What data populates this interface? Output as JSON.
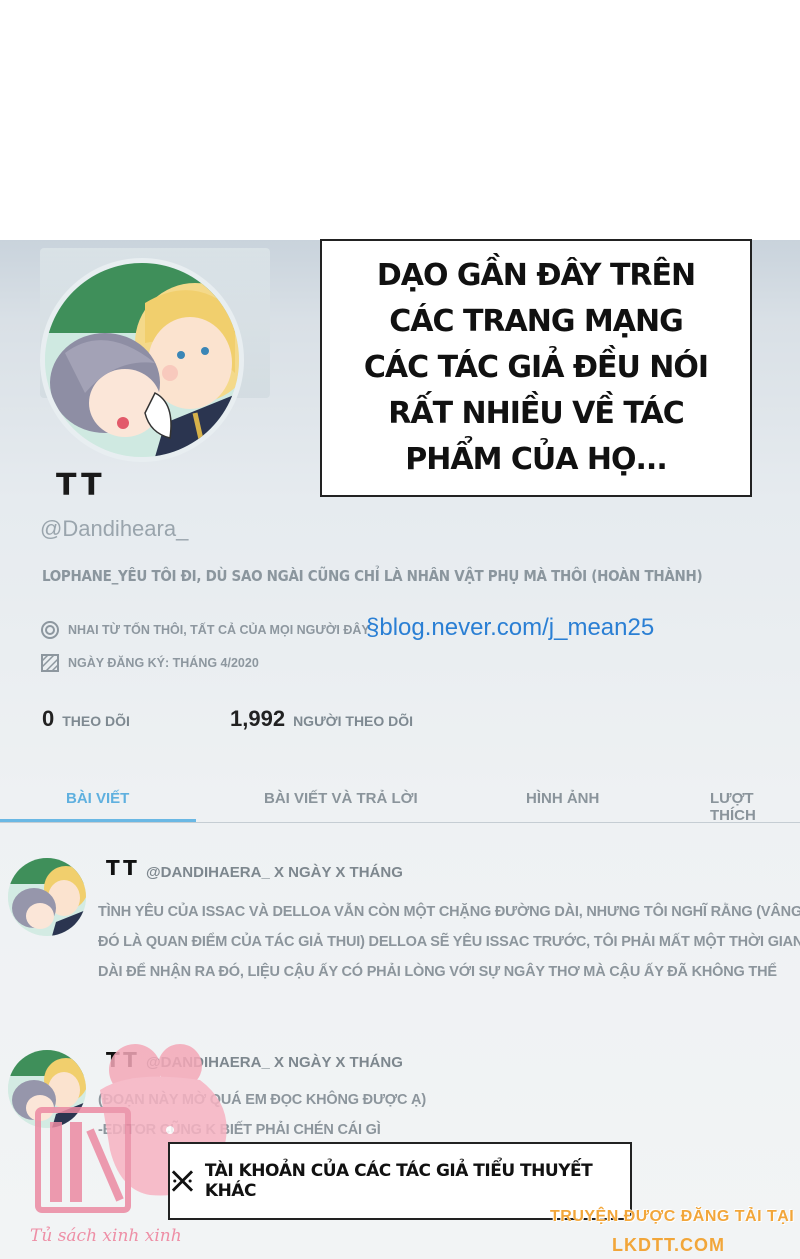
{
  "speech": {
    "text": "DẠO GẦN ĐÂY TRÊN CÁC TRANG MẠNG CÁC TÁC GIẢ ĐỀU NÓI RẤT NHIỀU VỀ TÁC PHẨM CỦA HỌ..."
  },
  "profile": {
    "display_name": "TT",
    "handle": "@Dandiheara_",
    "bio": "LOPHANE_YÊU TÔI ĐI, DÙ SAO NGÀI CŨNG CHỈ LÀ NHÂN VẬT PHỤ MÀ THÔI (HOÀN THÀNH)",
    "location": "NHAI TỪ TỐN THÔI, TẤT CẢ CỦA MỌI NGƯỜI ĐÂY",
    "link": "§blog.never.com/j_mean25",
    "joined": "NGÀY ĐĂNG KÝ: THÁNG 4/2020",
    "following_count": "0",
    "following_label": "THEO DÕI",
    "followers_count": "1,992",
    "followers_label": "NGƯỜI THEO DÕI"
  },
  "tabs": [
    {
      "label": "BÀI VIẾT",
      "active": true
    },
    {
      "label": "BÀI VIẾT VÀ TRẢ LỜI",
      "active": false
    },
    {
      "label": "HÌNH ẢNH",
      "active": false
    },
    {
      "label": "LƯỢT THÍCH",
      "active": false
    }
  ],
  "posts": [
    {
      "name": "TT",
      "meta": "@DANDIHAERA_ X NGÀY X THÁNG",
      "lines": [
        "TÌNH YÊU CỦA ISSAC VÀ DELLOA VẪN CÒN MỘT CHẶNG ĐƯỜNG DÀI, NHƯNG TÔI NGHĨ RẰNG (VÂNG",
        "ĐÓ LÀ QUAN ĐIỂM CỦA TÁC GIẢ THUI) DELLOA SẼ YÊU ISSAC TRƯỚC, TÔI PHẢI MẤT MỘT THỜI GIAN",
        "DÀI ĐỂ NHẬN RA ĐÓ, LIỆU CẬU ẤY CÓ PHẢI LÒNG VỚI SỰ NGÂY THƠ MÀ CẬU ẤY ĐÃ KHÔNG THỂ"
      ]
    },
    {
      "name": "TT",
      "meta": "@DANDIHAERA_ X NGÀY X THÁNG",
      "lines": [
        "(ĐOẠN NÀY MỜ QUÁ EM ĐỌC KHÔNG ĐƯỢC Ạ)",
        "-EDITOR CŨNG K BIẾT PHẢI CHÉN CÁI GÌ"
      ]
    }
  ],
  "bottom_box": {
    "icon": "x-mark-icon",
    "text": "TÀI KHOẢN CỦA CÁC TÁC GIẢ TIỂU THUYẾT KHÁC"
  },
  "watermark": {
    "text": "Tủ sách xinh xinh"
  },
  "site": {
    "line1": "TRUYỆN ĐƯỢC ĐĂNG TẢI TẠI",
    "line2": "LKDTT.COM"
  },
  "colors": {
    "accent_tab": "#5fb0df",
    "link": "#2a7fd4",
    "watermark_pink": "#ee8fa6",
    "site_orange": "#f2a63a"
  }
}
